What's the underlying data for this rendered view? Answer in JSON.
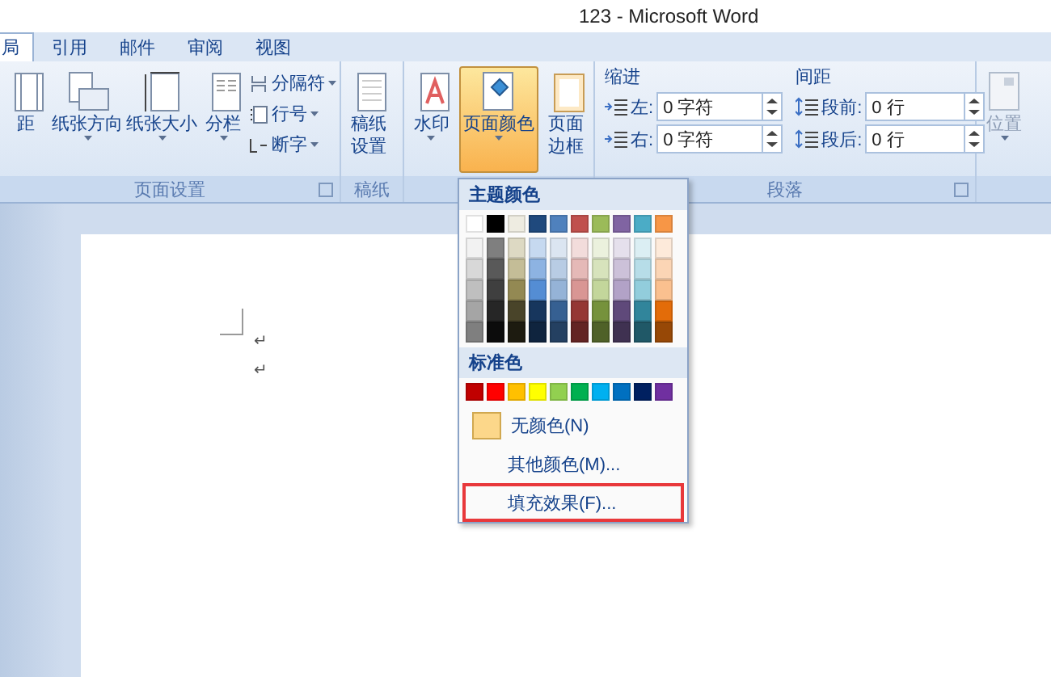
{
  "window": {
    "title": "123 - Microsoft Word"
  },
  "tabs": [
    {
      "label": "局",
      "selected": true
    },
    {
      "label": "引用",
      "selected": false
    },
    {
      "label": "邮件",
      "selected": false
    },
    {
      "label": "审阅",
      "selected": false
    },
    {
      "label": "视图",
      "selected": false
    }
  ],
  "ribbon": {
    "groups": [
      {
        "kind": "buttons",
        "label": "页面设置",
        "launcher": true,
        "buttons": [
          {
            "lines": [
              "距"
            ],
            "dropdown": false,
            "selected": false,
            "disabled": false
          },
          {
            "lines": [
              "纸张方向"
            ],
            "dropdown": true,
            "selected": false,
            "disabled": false
          },
          {
            "lines": [
              "纸张大小"
            ],
            "dropdown": true,
            "selected": false,
            "disabled": false
          },
          {
            "lines": [
              "分栏"
            ],
            "dropdown": true,
            "selected": false,
            "disabled": false
          }
        ],
        "small_buttons": [
          {
            "label": "分隔符"
          },
          {
            "label": "行号"
          },
          {
            "label": "断字"
          }
        ]
      },
      {
        "kind": "buttons",
        "label": "稿纸",
        "launcher": false,
        "buttons": [
          {
            "lines": [
              "稿纸",
              "设置"
            ],
            "dropdown": false,
            "selected": false,
            "disabled": false
          }
        ]
      },
      {
        "kind": "buttons",
        "launcher": false,
        "buttons": [
          {
            "lines": [
              "水印"
            ],
            "dropdown": true,
            "selected": false,
            "disabled": false
          },
          {
            "lines": [
              "页面颜色"
            ],
            "dropdown": true,
            "selected": true,
            "disabled": false
          },
          {
            "lines": [
              "页面",
              "边框"
            ],
            "dropdown": false,
            "selected": false,
            "disabled": false
          }
        ]
      },
      {
        "kind": "paragraph",
        "label": "段落",
        "launcher": true,
        "sections": [
          {
            "title": "缩进",
            "fields": [
              {
                "label": "左:",
                "value": "0 字符"
              },
              {
                "label": "右:",
                "value": "0 字符"
              }
            ]
          },
          {
            "title": "间距",
            "fields": [
              {
                "label": "段前:",
                "value": "0 行"
              },
              {
                "label": "段后:",
                "value": "0 行"
              }
            ]
          }
        ]
      },
      {
        "kind": "buttons",
        "launcher": false,
        "buttons": [
          {
            "lines": [
              "位置"
            ],
            "dropdown": true,
            "selected": false,
            "disabled": true
          }
        ]
      }
    ]
  },
  "color_menu": {
    "theme_title": "主题颜色",
    "theme_colors": [
      {
        "color": "#ffffff",
        "shades": [
          {
            "color": "#f2f2f2"
          },
          {
            "color": "#d8d8d8"
          },
          {
            "color": "#bfbfbf"
          },
          {
            "color": "#a5a5a5"
          },
          {
            "color": "#7f7f7f"
          }
        ]
      },
      {
        "color": "#000000",
        "shades": [
          {
            "color": "#7f7f7f"
          },
          {
            "color": "#595959"
          },
          {
            "color": "#3f3f3f"
          },
          {
            "color": "#262626"
          },
          {
            "color": "#0c0c0c"
          }
        ]
      },
      {
        "color": "#eeece1",
        "shades": [
          {
            "color": "#ddd9c3"
          },
          {
            "color": "#c4bd97"
          },
          {
            "color": "#938953"
          },
          {
            "color": "#494429"
          },
          {
            "color": "#1d1b10"
          }
        ]
      },
      {
        "color": "#1f497d",
        "shades": [
          {
            "color": "#c6d9f0"
          },
          {
            "color": "#8db3e2"
          },
          {
            "color": "#548dd4"
          },
          {
            "color": "#17365d"
          },
          {
            "color": "#0f243e"
          }
        ]
      },
      {
        "color": "#4f81bd",
        "shades": [
          {
            "color": "#dbe5f1"
          },
          {
            "color": "#b8cce4"
          },
          {
            "color": "#95b3d7"
          },
          {
            "color": "#366092"
          },
          {
            "color": "#244061"
          }
        ]
      },
      {
        "color": "#c0504d",
        "shades": [
          {
            "color": "#f2dcdb"
          },
          {
            "color": "#e5b9b7"
          },
          {
            "color": "#d99694"
          },
          {
            "color": "#953734"
          },
          {
            "color": "#632423"
          }
        ]
      },
      {
        "color": "#9bbb59",
        "shades": [
          {
            "color": "#ebf1dd"
          },
          {
            "color": "#d7e3bc"
          },
          {
            "color": "#c3d69b"
          },
          {
            "color": "#76923c"
          },
          {
            "color": "#4f6128"
          }
        ]
      },
      {
        "color": "#8064a2",
        "shades": [
          {
            "color": "#e5e0ec"
          },
          {
            "color": "#ccc1d9"
          },
          {
            "color": "#b2a2c7"
          },
          {
            "color": "#5f497a"
          },
          {
            "color": "#3f3151"
          }
        ]
      },
      {
        "color": "#4bacc6",
        "shades": [
          {
            "color": "#dbeef3"
          },
          {
            "color": "#b7dde8"
          },
          {
            "color": "#92cddc"
          },
          {
            "color": "#31859b"
          },
          {
            "color": "#205867"
          }
        ]
      },
      {
        "color": "#f79646",
        "shades": [
          {
            "color": "#fdeada"
          },
          {
            "color": "#fbd5b5"
          },
          {
            "color": "#fac08f"
          },
          {
            "color": "#e36c09"
          },
          {
            "color": "#974806"
          }
        ]
      }
    ],
    "standard_title": "标准色",
    "standard_colors": [
      {
        "color": "#c00000"
      },
      {
        "color": "#ff0000"
      },
      {
        "color": "#ffc000"
      },
      {
        "color": "#ffff00"
      },
      {
        "color": "#92d050"
      },
      {
        "color": "#00b050"
      },
      {
        "color": "#00b0f0"
      },
      {
        "color": "#0070c0"
      },
      {
        "color": "#002060"
      },
      {
        "color": "#7030a0"
      }
    ],
    "items": [
      {
        "label": "无颜色(N)",
        "swatch": true,
        "highlighted": false
      },
      {
        "label": "其他颜色(M)...",
        "swatch": false,
        "highlighted": false
      },
      {
        "label": "填充效果(F)...",
        "swatch": false,
        "highlighted": true
      }
    ]
  },
  "document": {
    "paragraph_marks": [
      "↵",
      "↵"
    ]
  }
}
